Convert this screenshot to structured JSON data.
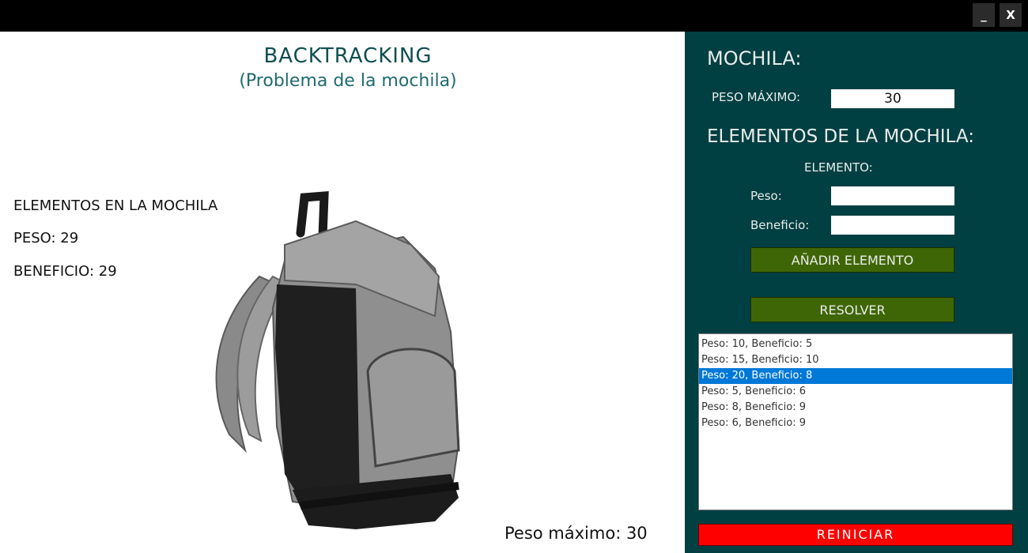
{
  "window": {
    "minimize_label": "_",
    "close_label": "X"
  },
  "left": {
    "title": "BACKTRACKING",
    "subtitle": "(Problema de la mochila)",
    "elements_heading": "ELEMENTOS EN LA MOCHILA",
    "peso_text": "PESO: 29",
    "beneficio_text": "BENEFICIO: 29",
    "peso_maximo_text": "Peso máximo: 30",
    "image_name": "backpack-image"
  },
  "panel": {
    "heading": "MOCHILA:",
    "peso_maximo_label": "PESO MÁXIMO:",
    "peso_maximo_value": "30",
    "elements_heading": "ELEMENTOS DE LA MOCHILA:",
    "elemento_label": "ELEMENTO:",
    "peso_label": "Peso:",
    "peso_value": "",
    "beneficio_label": "Beneficio:",
    "beneficio_value": "",
    "add_button": "AÑADIR ELEMENTO",
    "solve_button": "RESOLVER",
    "items": [
      "Peso: 10, Beneficio: 5",
      "Peso: 15, Beneficio: 10",
      "Peso: 20, Beneficio: 8",
      "Peso: 5, Beneficio: 6",
      "Peso: 8, Beneficio: 9",
      "Peso: 6, Beneficio: 9"
    ],
    "selected_index": 2,
    "reset_button": "REINICIAR"
  },
  "colors": {
    "panel_bg": "#003f42",
    "button_green": "#3f6606",
    "reset_red": "#ff0000",
    "selection_blue": "#0078d7",
    "title_teal": "#0f4f52"
  }
}
